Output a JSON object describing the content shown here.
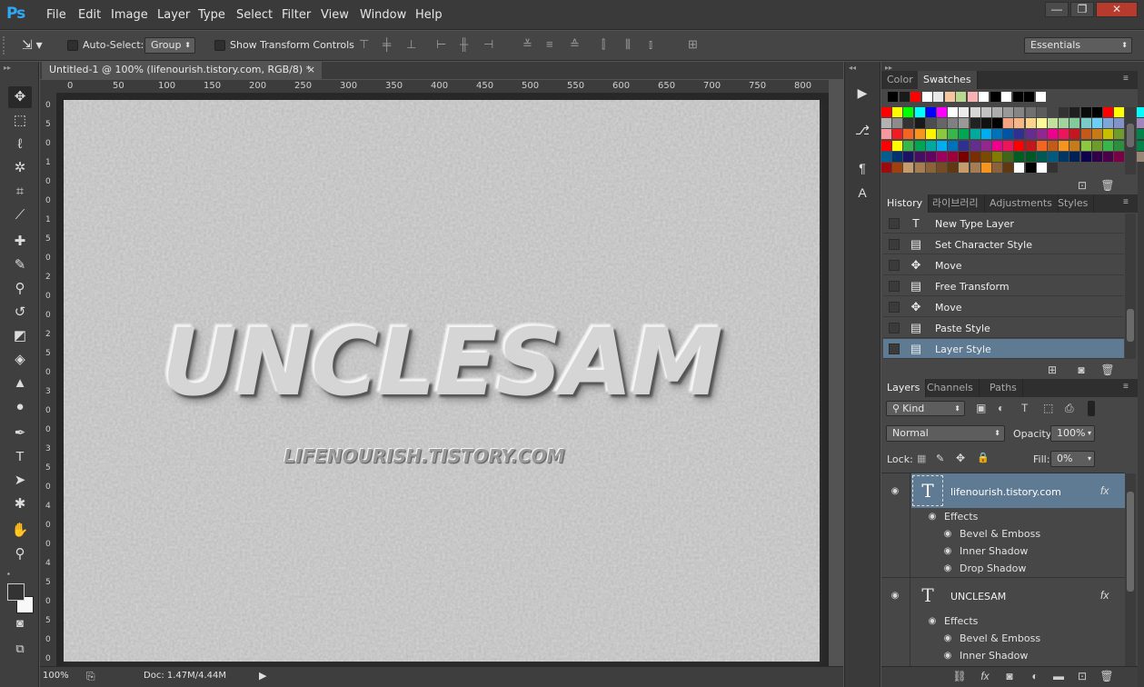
{
  "app": {
    "logo": "Ps"
  },
  "menu": [
    "File",
    "Edit",
    "Image",
    "Layer",
    "Type",
    "Select",
    "Filter",
    "View",
    "Window",
    "Help"
  ],
  "window_controls": {
    "minimize": "—",
    "maximize": "❐",
    "close": "✕"
  },
  "options_bar": {
    "auto_select_label": "Auto-Select:",
    "auto_select_value": "Group",
    "show_transform_label": "Show Transform Controls",
    "workspace": "Essentials"
  },
  "document": {
    "tab_title": "Untitled-1 @ 100% (lifenourish.tistory.com, RGB/8) *",
    "close": "×"
  },
  "rulers": {
    "h": [
      "0",
      "50",
      "100",
      "150",
      "200",
      "250",
      "300",
      "350",
      "400",
      "450",
      "500",
      "550",
      "600",
      "650",
      "700",
      "750",
      "800"
    ],
    "v": [
      "0",
      "5",
      "0",
      "1",
      "0",
      "0",
      "1",
      "5",
      "0",
      "2",
      "0",
      "0",
      "2",
      "5",
      "0",
      "3",
      "0",
      "0",
      "3",
      "5",
      "0",
      "4",
      "0",
      "0",
      "4",
      "5",
      "0",
      "5",
      "0",
      "0"
    ]
  },
  "canvas": {
    "title_text": "UNCLESAM",
    "subtitle_text": "LIFENOURISH.TISTORY.COM"
  },
  "status": {
    "zoom": "100%",
    "doc": "Doc: 1.47M/4.44M"
  },
  "color_panel": {
    "tabs": [
      "Color",
      "Swatches"
    ],
    "active": "Swatches"
  },
  "history_panel": {
    "tabs": [
      "History",
      "라이브러리",
      "Adjustments",
      "Styles"
    ],
    "items": [
      {
        "label": "New Type Layer",
        "icon": "type-icon"
      },
      {
        "label": "Set Character Style",
        "icon": "document-icon"
      },
      {
        "label": "Move",
        "icon": "move-icon"
      },
      {
        "label": "Free Transform",
        "icon": "document-icon"
      },
      {
        "label": "Move",
        "icon": "move-icon"
      },
      {
        "label": "Paste Style",
        "icon": "document-icon"
      },
      {
        "label": "Layer Style",
        "icon": "document-icon"
      }
    ]
  },
  "layers_panel": {
    "tabs": [
      "Layers",
      "Channels",
      "Paths"
    ],
    "filter": "Kind",
    "blend_mode": "Normal",
    "opacity_label": "Opacity:",
    "opacity": "100%",
    "lock_label": "Lock:",
    "fill_label": "Fill:",
    "fill": "0%",
    "layers": [
      {
        "name": "lifenourish.tistory.com",
        "effects_label": "Effects",
        "effects": [
          "Bevel & Emboss",
          "Inner Shadow",
          "Drop Shadow"
        ],
        "selected": true
      },
      {
        "name": "UNCLESAM",
        "effects_label": "Effects",
        "effects": [
          "Bevel & Emboss",
          "Inner Shadow"
        ],
        "selected": false
      }
    ],
    "fx": "fx"
  },
  "colors": {
    "accent": "#2fa8f5",
    "selection": "#5e7b93",
    "canvas": "#d2d2d2"
  },
  "swatches": {
    "recent": [
      "#000000",
      "#1a1a1a",
      "#ff0000",
      "#ffffff",
      "#e8e8e8",
      "#f4c6a0",
      "#b8d890",
      "#f7b3b3",
      "#ffffff",
      "#000000",
      "#ffffff",
      "#000000",
      "#000000",
      "#ffffff"
    ],
    "grid": [
      [
        "#ff0000",
        "#ffff00",
        "#00ff00",
        "#00ffff",
        "#0000ff",
        "#ff00ff",
        "#ffffff",
        "#ebebeb",
        "#d6d6d6",
        "#c2c2c2",
        "#adadad",
        "#999999",
        "#858585",
        "#707070",
        "#5c5c5c",
        "#474747",
        "#333333",
        "#1f1f1f",
        "#0a0a0a",
        "#000000",
        "#ff0000",
        "#ffff00",
        "#00ff00",
        "#00ffff",
        "#0000ff",
        "#ff00ff"
      ],
      [
        "#b2b2b2",
        "#8c8c8c",
        "#333333",
        "#1a1a1a",
        "#4d4d4d",
        "#666666",
        "#808080",
        "#999999",
        "#222222",
        "#111111",
        "#000000",
        "#f3a282",
        "#f7b685",
        "#fcd58c",
        "#fff899",
        "#c4df9b",
        "#a3d39c",
        "#82ca9c",
        "#7accc8",
        "#6dcff6",
        "#7da7d8",
        "#8393ca",
        "#8781bd",
        "#a186be",
        "#bc8dbf",
        "#f49ac2"
      ],
      [
        "#f6989d",
        "#ee1d24",
        "#f26522",
        "#f7941d",
        "#fff200",
        "#8dc63f",
        "#39b54a",
        "#00a651",
        "#00a99d",
        "#00aeef",
        "#0072bc",
        "#0054a6",
        "#2e3192",
        "#662d91",
        "#92278f",
        "#ec008c",
        "#ed145b",
        "#c4161c",
        "#c45a1a",
        "#c77b16",
        "#c6c000",
        "#6f9b2c",
        "#2b8f3e",
        "#00844a",
        "#00867a",
        "#0089c0"
      ],
      [
        "#ff0000",
        "#ffff00",
        "#39b54a",
        "#00a651",
        "#00a99d",
        "#00aeef",
        "#0072bc",
        "#2e3192",
        "#662d91",
        "#92278f",
        "#ec008c",
        "#ed145b",
        "#ff0000",
        "#c4161c",
        "#f26522",
        "#c45a1a",
        "#f7941d",
        "#c77b16",
        "#8dc63f",
        "#6f9b2c",
        "#39b54a",
        "#2b8f3e",
        "#00a651",
        "#00844a",
        "#00a99d",
        "#00867a"
      ],
      [
        "#005e93",
        "#003471",
        "#1b1464",
        "#440e62",
        "#630460",
        "#9e005d",
        "#9e0039",
        "#790000",
        "#7a2e00",
        "#7b4900",
        "#827b00",
        "#406618",
        "#005e20",
        "#005826",
        "#005952",
        "#005b7f",
        "#003663",
        "#002157",
        "#0d004c",
        "#32004b",
        "#4b0049",
        "#7b0046",
        "#7a0026",
        "#998675",
        "#736357",
        "#534741"
      ],
      [
        "#9e0b0f",
        "#a0410d",
        "#c69c6d",
        "#a67c52",
        "#8c6239",
        "#754c24",
        "#603913",
        "#c69c6d",
        "#a67c52",
        "#f7941d",
        "#8c6239",
        "#603913",
        "#ffffff",
        "#000000",
        "#ffffff",
        "#333333"
      ]
    ]
  }
}
